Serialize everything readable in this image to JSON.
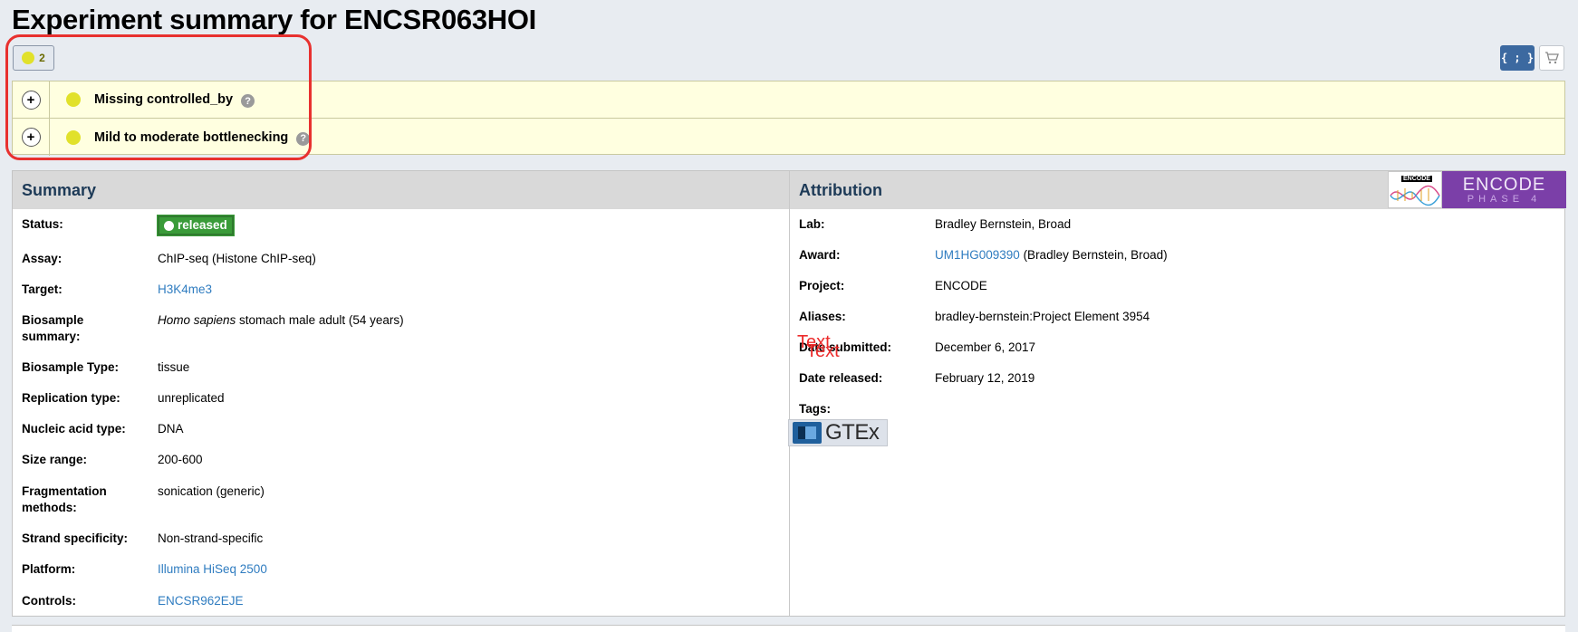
{
  "page": {
    "title": "Experiment summary for ENCSR063HOI"
  },
  "toolbar": {
    "audit_count": "2",
    "json_label": "{ ; }"
  },
  "audits": [
    {
      "label": "Missing controlled_by",
      "help": "?"
    },
    {
      "label": "Mild to moderate bottlenecking",
      "help": "?"
    }
  ],
  "summary": {
    "heading": "Summary",
    "rows": {
      "status": {
        "key": "Status:",
        "value": "released"
      },
      "assay": {
        "key": "Assay:",
        "value": "ChIP-seq (Histone ChIP-seq)"
      },
      "target": {
        "key": "Target:",
        "value": "H3K4me3"
      },
      "biosample_summary": {
        "key": "Biosample summary:",
        "species": "Homo sapiens",
        "value": " stomach male adult (54 years)"
      },
      "biosample_type": {
        "key": "Biosample Type:",
        "value": "tissue"
      },
      "replication_type": {
        "key": "Replication type:",
        "value": "unreplicated"
      },
      "nucleic_acid_type": {
        "key": "Nucleic acid type:",
        "value": "DNA"
      },
      "size_range": {
        "key": "Size range:",
        "value": "200-600"
      },
      "fragmentation": {
        "key": "Fragmentation methods:",
        "value": "sonication (generic)"
      },
      "strand": {
        "key": "Strand specificity:",
        "value": "Non-strand-specific"
      },
      "platform": {
        "key": "Platform:",
        "value": "Illumina HiSeq 2500"
      },
      "controls": {
        "key": "Controls:",
        "value": "ENCSR962EJE"
      }
    }
  },
  "attribution": {
    "heading": "Attribution",
    "logo": {
      "mini": "ENCODE",
      "big": "ENCODE",
      "small": "PHASE 4"
    },
    "rows": {
      "lab": {
        "key": "Lab:",
        "value": "Bradley Bernstein, Broad"
      },
      "award": {
        "key": "Award:",
        "link": "UM1HG009390",
        "value": " (Bradley Bernstein, Broad)"
      },
      "project": {
        "key": "Project:",
        "value": "ENCODE"
      },
      "aliases": {
        "key": "Aliases:",
        "value": "bradley-bernstein:Project Element 3954"
      },
      "date_submitted": {
        "key": "Date submitted:",
        "value": "December 6, 2017"
      },
      "date_released": {
        "key": "Date released:",
        "value": "February 12, 2019"
      },
      "tags": {
        "key": "Tags:",
        "tag": "GTEx"
      }
    }
  },
  "overlay": {
    "text1": "Text",
    "text2": "Text"
  },
  "colors": {
    "accent": "#3c69a0",
    "audit_yellow": "#e1e12b",
    "status_green": "#3a9b39",
    "link": "#2f7cc0",
    "highlight": "#e8312f"
  }
}
